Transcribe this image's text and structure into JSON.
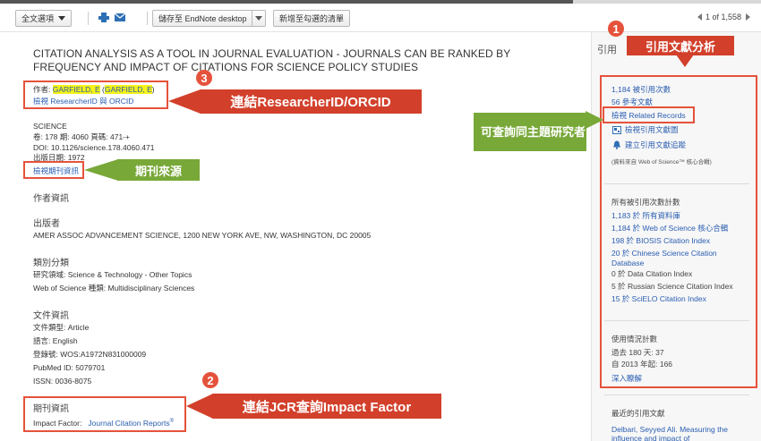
{
  "toolbar": {
    "full_text_label": "全文選項",
    "save_label": "儲存至 EndNote desktop",
    "add_marked_label": "新增至勾選的清單",
    "pager_current": "1",
    "pager_of": "of 1,558"
  },
  "record": {
    "title": "CITATION ANALYSIS AS A TOOL IN JOURNAL EVALUATION - JOURNALS CAN BE RANKED BY FREQUENCY AND IMPACT OF CITATIONS FOR SCIENCE POLICY STUDIES",
    "author_label": "作者:",
    "author_name": "GARFIELD, E",
    "author_paren": "GARFIELD, E",
    "researcher_link": "檢視 ResearcherID 與 ORCID",
    "journal": "SCIENCE",
    "volume_line": "卷: 178 期: 4060 頁碼: 471-+",
    "doi_line": "DOI: 10.1126/science.178.4060.471",
    "pub_date_line": "出版日期: 1972",
    "journal_info_link": "檢視期刊資訊"
  },
  "sections": {
    "author_info": "作者資訊",
    "publisher_h": "出版者",
    "publisher": "AMER ASSOC ADVANCEMENT SCIENCE, 1200 NEW YORK AVE, NW, WASHINGTON, DC 20005",
    "category_h": "類別分類",
    "research_area": "研究領域: Science & Technology - Other Topics",
    "wos_category": "Web of Science 種類: Multidisciplinary Sciences",
    "doc_info_h": "文件資訊",
    "doc_type": "文件類型: Article",
    "language": "語言: English",
    "accession": "登錄號: WOS:A1972N831000009",
    "pubmed": "PubMed ID: 5079701",
    "issn": "ISSN: 0036-8075",
    "journal_info_h": "期刊資訊",
    "impact_label": "Impact Factor:",
    "jcr_link": "Journal Citation Reports"
  },
  "right_panel": {
    "network_h": "引用",
    "times_cited": "1,184 被引用次數",
    "cited_refs": "56 參考文獻",
    "related_records": "檢視 Related Records",
    "citation_map": "檢視引用文獻圖",
    "citation_alert": "建立引用文獻追蹤",
    "data_from": "(資料來自 Web of Science™ 核心合輯)",
    "all_counts_h": "所有被引用次數計數",
    "counts": [
      "1,183 於 所有資料庫",
      "1,184 於 Web of Science 核心合輯",
      "198 於 BIOSIS Citation Index",
      "20 於 Chinese Science Citation Database",
      "0 於 Data Citation Index",
      "5 於 Russian Science Citation Index",
      "15 於 SciELO Citation Index"
    ],
    "usage_h": "使用情況計數",
    "usage_180": "過去 180 天: 37",
    "usage_2013": "自 2013 年起: 166",
    "learn_more": "深入瞭解",
    "recent_h": "最近的引用文獻",
    "recent_1": "Delbari, Seyyed Ali. Measuring the",
    "recent_2": "influence and impact of"
  },
  "annotations": {
    "c1_num": "1",
    "c1_label": "引用文獻分析",
    "c2_num": "2",
    "c2_label": "連結JCR查詢Impact Factor",
    "c3_num": "3",
    "c3_label": "連結ResearcherID/ORCID",
    "green_topic": "可查詢同主題研究者",
    "green_source": "期刊來源"
  },
  "colors": {
    "annotation_red": "#d2402b",
    "annotation_green": "#78a838",
    "highlight": "#f4f21a",
    "link": "#2a5db0"
  }
}
